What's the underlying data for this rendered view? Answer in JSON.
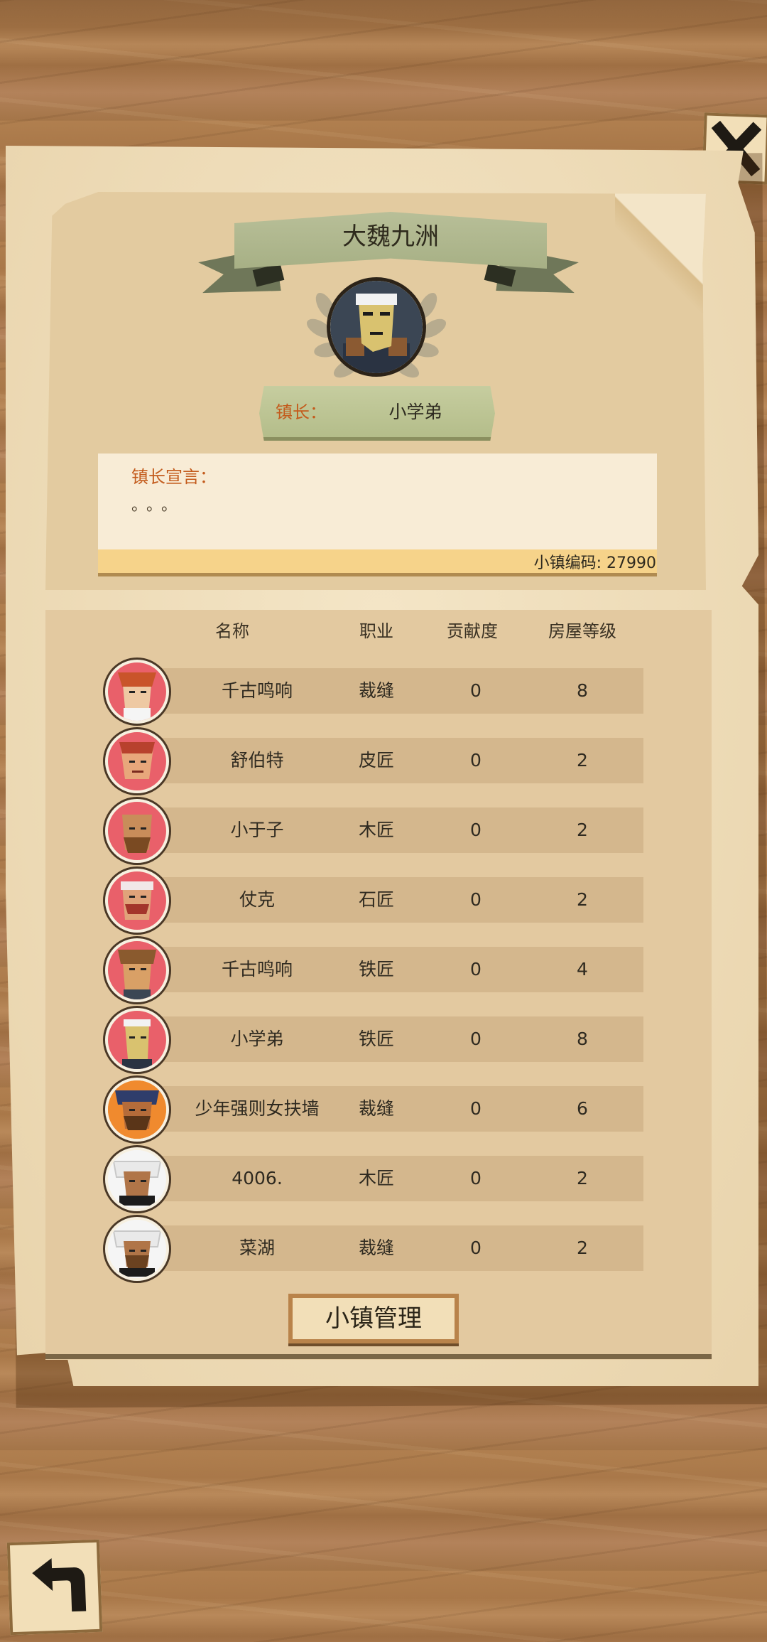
{
  "town": {
    "name": "大魏九洲",
    "mayor_label": "镇长：",
    "mayor_name": "小学弟",
    "declaration_label": "镇长宣言：",
    "declaration_text": "。。。",
    "code_text": "小镇编码: 27990"
  },
  "table": {
    "headers": {
      "name": "名称",
      "job": "职业",
      "contribution": "贡献度",
      "house_level": "房屋等级"
    },
    "members": [
      {
        "name": "千古鸣响",
        "job": "裁缝",
        "contribution": "0",
        "house_level": "8"
      },
      {
        "name": "舒伯特",
        "job": "皮匠",
        "contribution": "0",
        "house_level": "2"
      },
      {
        "name": "小于子",
        "job": "木匠",
        "contribution": "0",
        "house_level": "2"
      },
      {
        "name": "仗克",
        "job": "石匠",
        "contribution": "0",
        "house_level": "2"
      },
      {
        "name": "千古鸣响",
        "job": "铁匠",
        "contribution": "0",
        "house_level": "4"
      },
      {
        "name": "小学弟",
        "job": "铁匠",
        "contribution": "0",
        "house_level": "8"
      },
      {
        "name": "少年强则女扶墙",
        "job": "裁缝",
        "contribution": "0",
        "house_level": "6"
      },
      {
        "name": "4006.",
        "job": "木匠",
        "contribution": "0",
        "house_level": "2"
      },
      {
        "name": "菜湖",
        "job": "裁缝",
        "contribution": "0",
        "house_level": "2"
      }
    ]
  },
  "buttons": {
    "manage_label": "小镇管理",
    "close_icon": "close-x-icon",
    "back_icon": "back-arrow-icon"
  },
  "colors": {
    "paper": "#f2e1bd",
    "ribbon": "#a7b085",
    "accent_label": "#c35b1c",
    "row": "#d4b78d",
    "avatar_pink": "#e9606a",
    "avatar_white": "#f5f5f5"
  }
}
